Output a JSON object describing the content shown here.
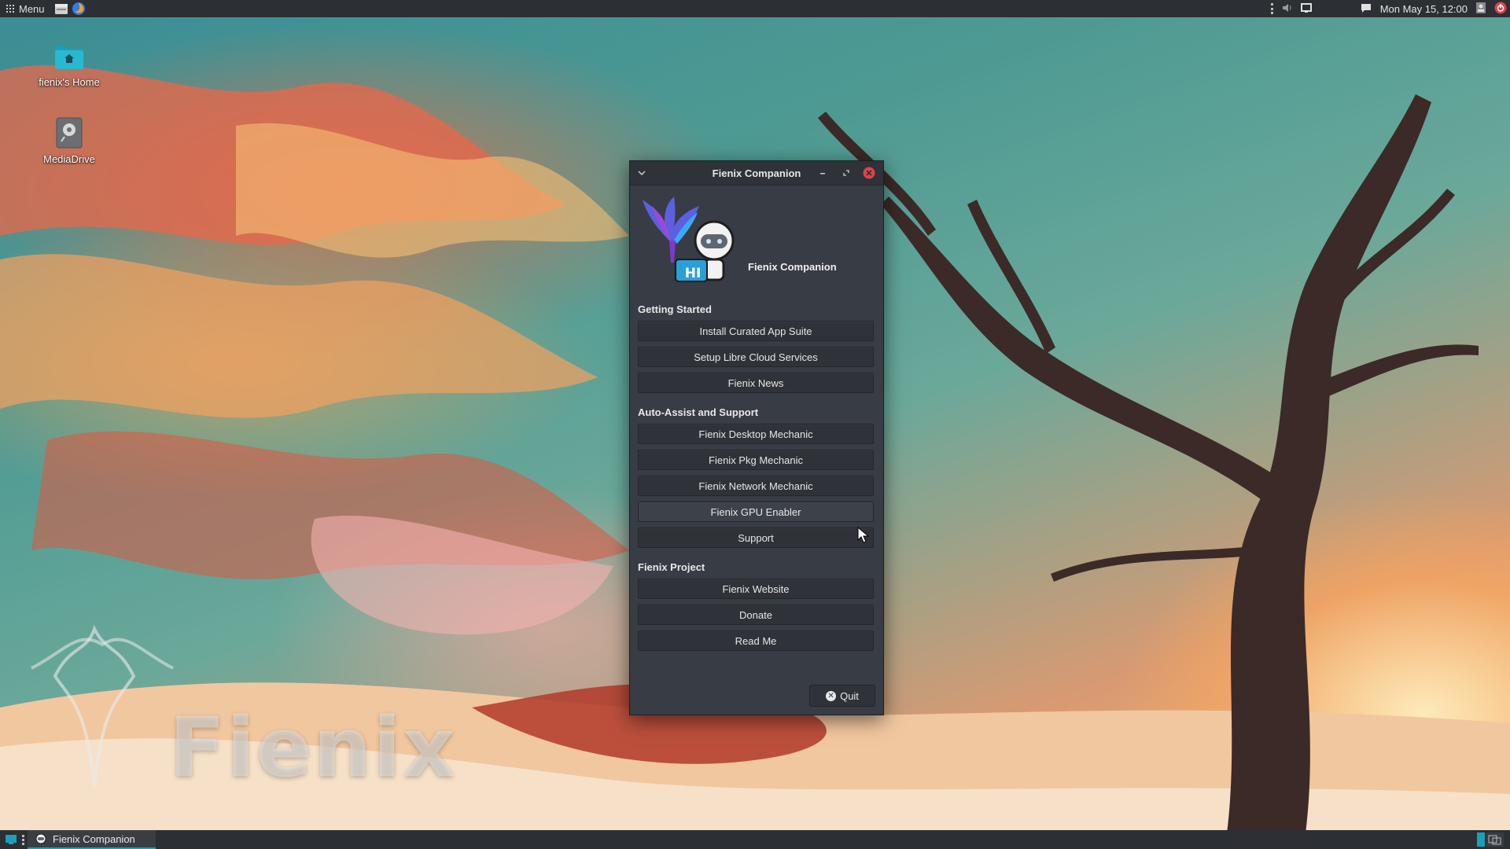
{
  "top_panel": {
    "menu_label": "Menu",
    "clock": "Mon May 15, 12:00",
    "launcher_icons": [
      "file-manager-icon",
      "firefox-icon"
    ],
    "tray_icons": [
      "volume-icon",
      "display-icon",
      "chat-icon",
      "user-icon",
      "power-icon"
    ]
  },
  "desktop": {
    "icons": [
      {
        "label": "fienix's Home",
        "icon": "home-folder-icon"
      },
      {
        "label": "MediaDrive",
        "icon": "drive-icon"
      }
    ],
    "watermark": "Fienix"
  },
  "window": {
    "title": "Fienix Companion",
    "header_title": "Fienix Companion",
    "mascot_badge": "HI",
    "sections": [
      {
        "label": "Getting Started",
        "buttons": [
          "Install Curated App Suite",
          "Setup Libre Cloud Services",
          "Fienix News"
        ]
      },
      {
        "label": "Auto-Assist and Support",
        "buttons": [
          "Fienix Desktop Mechanic",
          "Fienix Pkg Mechanic",
          "Fienix Network Mechanic",
          "Fienix GPU Enabler",
          "Support"
        ]
      },
      {
        "label": "Fienix Project",
        "buttons": [
          "Fienix Website",
          "Donate",
          "Read Me"
        ]
      }
    ],
    "quit_label": "Quit"
  },
  "taskbar": {
    "item_label": "Fienix Companion"
  },
  "colors": {
    "panel": "#2c2f33",
    "window_bg": "#383c44",
    "accent": "#1aa0b8",
    "close": "#e0424a"
  }
}
